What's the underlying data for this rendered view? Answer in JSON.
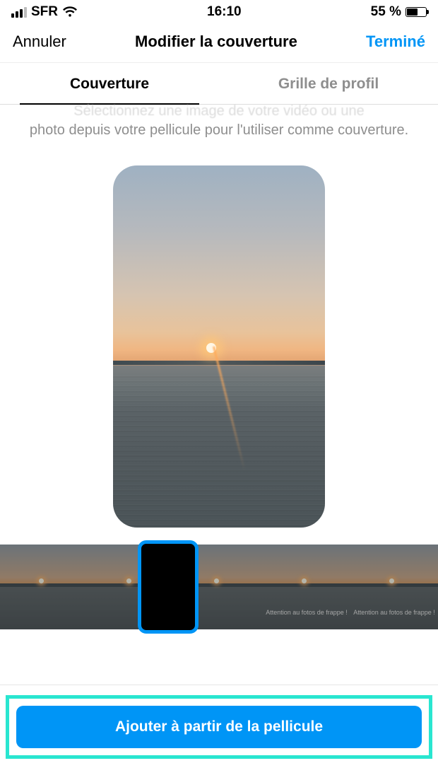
{
  "status": {
    "carrier": "SFR",
    "time": "16:10",
    "battery_pct": "55 %"
  },
  "nav": {
    "cancel": "Annuler",
    "title": "Modifier la couverture",
    "done": "Terminé"
  },
  "tabs": {
    "cover": "Couverture",
    "grid": "Grille de profil"
  },
  "hint": {
    "line1": "Sélectionnez une image de votre vidéo ou une",
    "line2": "photo depuis votre pellicule pour l'utiliser comme couverture."
  },
  "frames": {
    "overlay_caption": "Attention au fotos de frappe !"
  },
  "button": {
    "add_from_roll": "Ajouter à partir de la pellicule"
  }
}
